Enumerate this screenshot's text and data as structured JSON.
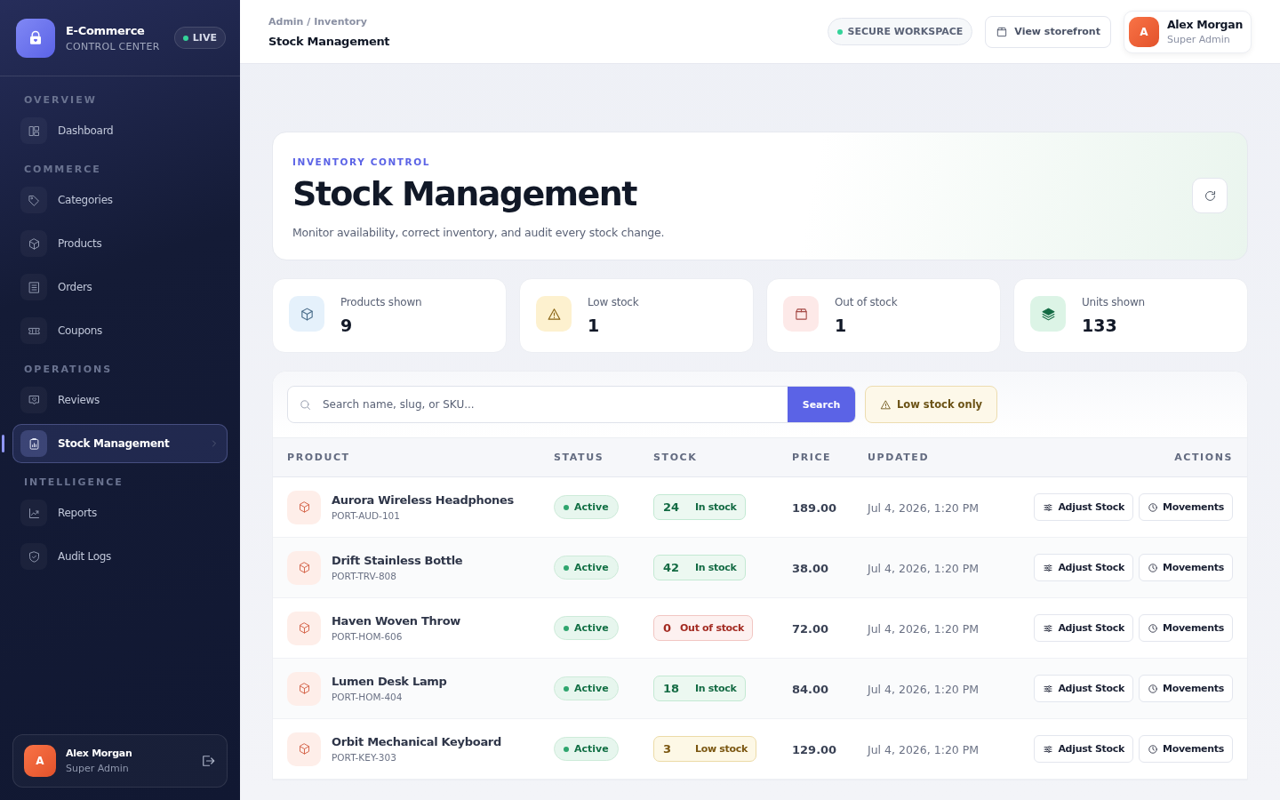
{
  "sidebar": {
    "brand": {
      "title": "E-Commerce",
      "subtitle": "CONTROL CENTER",
      "badge": "LIVE"
    },
    "sections": [
      {
        "title": "OVERVIEW",
        "items": [
          {
            "label": "Dashboard",
            "selected": false
          }
        ]
      },
      {
        "title": "COMMERCE",
        "items": [
          {
            "label": "Categories",
            "selected": false
          },
          {
            "label": "Products",
            "selected": false
          },
          {
            "label": "Orders",
            "selected": false
          },
          {
            "label": "Coupons",
            "selected": false
          }
        ]
      },
      {
        "title": "OPERATIONS",
        "items": [
          {
            "label": "Reviews",
            "selected": false
          },
          {
            "label": "Stock Management",
            "selected": true
          }
        ]
      },
      {
        "title": "INTELLIGENCE",
        "items": [
          {
            "label": "Reports",
            "selected": false
          },
          {
            "label": "Audit Logs",
            "selected": false
          }
        ]
      }
    ],
    "user": {
      "initial": "A",
      "name": "Alex Morgan",
      "role": "Super Admin"
    }
  },
  "header": {
    "breadcrumb": "Admin / Inventory",
    "title": "Stock Management",
    "workspace_badge": "SECURE WORKSPACE",
    "storefront_button": "View storefront",
    "user": {
      "initial": "A",
      "name": "Alex Morgan",
      "role": "Super Admin"
    }
  },
  "hero": {
    "eyebrow": "INVENTORY CONTROL",
    "title": "Stock Management",
    "description": "Monitor availability, correct inventory, and audit every stock change."
  },
  "stats": [
    {
      "kind": "products",
      "label": "Products shown",
      "value": "9"
    },
    {
      "kind": "low",
      "label": "Low stock",
      "value": "1"
    },
    {
      "kind": "out",
      "label": "Out of stock",
      "value": "1"
    },
    {
      "kind": "units",
      "label": "Units shown",
      "value": "133"
    }
  ],
  "filters": {
    "search_placeholder": "Search name, slug, or SKU...",
    "search_button": "Search",
    "low_stock_button": "Low stock only"
  },
  "table": {
    "columns": [
      "PRODUCT",
      "STATUS",
      "STOCK",
      "PRICE",
      "UPDATED",
      "ACTIONS"
    ],
    "rows": [
      {
        "name": "Aurora Wireless Headphones",
        "sku": "PORT-AUD-101",
        "status": "Active",
        "stock": "24",
        "kind": "in",
        "stock_label": "In stock",
        "price": "189.00",
        "updated": "Jul 4, 2026, 1:20 PM",
        "actions": [
          "Adjust Stock",
          "Movements"
        ]
      },
      {
        "name": "Drift Stainless Bottle",
        "sku": "PORT-TRV-808",
        "status": "Active",
        "stock": "42",
        "kind": "in",
        "stock_label": "In stock",
        "price": "38.00",
        "updated": "Jul 4, 2026, 1:20 PM",
        "actions": [
          "Adjust Stock",
          "Movements"
        ]
      },
      {
        "name": "Haven Woven Throw",
        "sku": "PORT-HOM-606",
        "status": "Active",
        "stock": "0",
        "kind": "out",
        "stock_label": "Out of stock",
        "price": "72.00",
        "updated": "Jul 4, 2026, 1:20 PM",
        "actions": [
          "Adjust Stock",
          "Movements"
        ]
      },
      {
        "name": "Lumen Desk Lamp",
        "sku": "PORT-HOM-404",
        "status": "Active",
        "stock": "18",
        "kind": "in",
        "stock_label": "In stock",
        "price": "84.00",
        "updated": "Jul 4, 2026, 1:20 PM",
        "actions": [
          "Adjust Stock",
          "Movements"
        ]
      },
      {
        "name": "Orbit Mechanical Keyboard",
        "sku": "PORT-KEY-303",
        "status": "Active",
        "stock": "3",
        "kind": "low",
        "stock_label": "Low stock",
        "price": "129.00",
        "updated": "Jul 4, 2026, 1:20 PM",
        "actions": [
          "Adjust Stock",
          "Movements"
        ]
      }
    ]
  }
}
